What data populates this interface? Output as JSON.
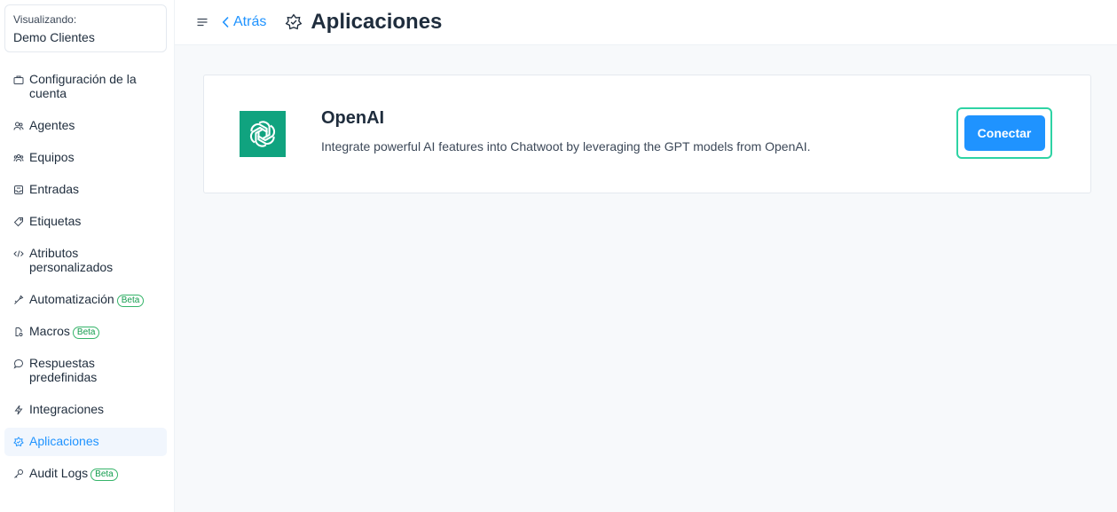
{
  "account": {
    "label": "Visualizando:",
    "name": "Demo Clientes"
  },
  "sidebar": {
    "items": [
      {
        "label": "Configuración de la cuenta",
        "icon": "briefcase-icon"
      },
      {
        "label": "Agentes",
        "icon": "people-icon"
      },
      {
        "label": "Equipos",
        "icon": "team-icon"
      },
      {
        "label": "Entradas",
        "icon": "inbox-icon"
      },
      {
        "label": "Etiquetas",
        "icon": "tag-icon"
      },
      {
        "label": "Atributos personalizados",
        "icon": "code-icon"
      },
      {
        "label": "Automatización",
        "icon": "automation-icon",
        "badge": "Beta"
      },
      {
        "label": "Macros",
        "icon": "macro-icon",
        "badge": "Beta"
      },
      {
        "label": "Respuestas predefinidas",
        "icon": "chat-bubble-icon"
      },
      {
        "label": "Integraciones",
        "icon": "flash-icon"
      },
      {
        "label": "Aplicaciones",
        "icon": "star-badge-icon",
        "active": true
      },
      {
        "label": "Audit Logs",
        "icon": "key-icon",
        "badge": "Beta"
      }
    ]
  },
  "header": {
    "back_label": "Atrás",
    "title": "Aplicaciones"
  },
  "app_card": {
    "name": "OpenAI",
    "description": "Integrate powerful AI features into Chatwoot by leveraging the GPT models from OpenAI.",
    "connect_label": "Conectar",
    "logo_color": "#10a37f"
  },
  "colors": {
    "accent": "#1f93ff",
    "beta": "#36b46a",
    "focus_ring": "#2ed3a4"
  }
}
